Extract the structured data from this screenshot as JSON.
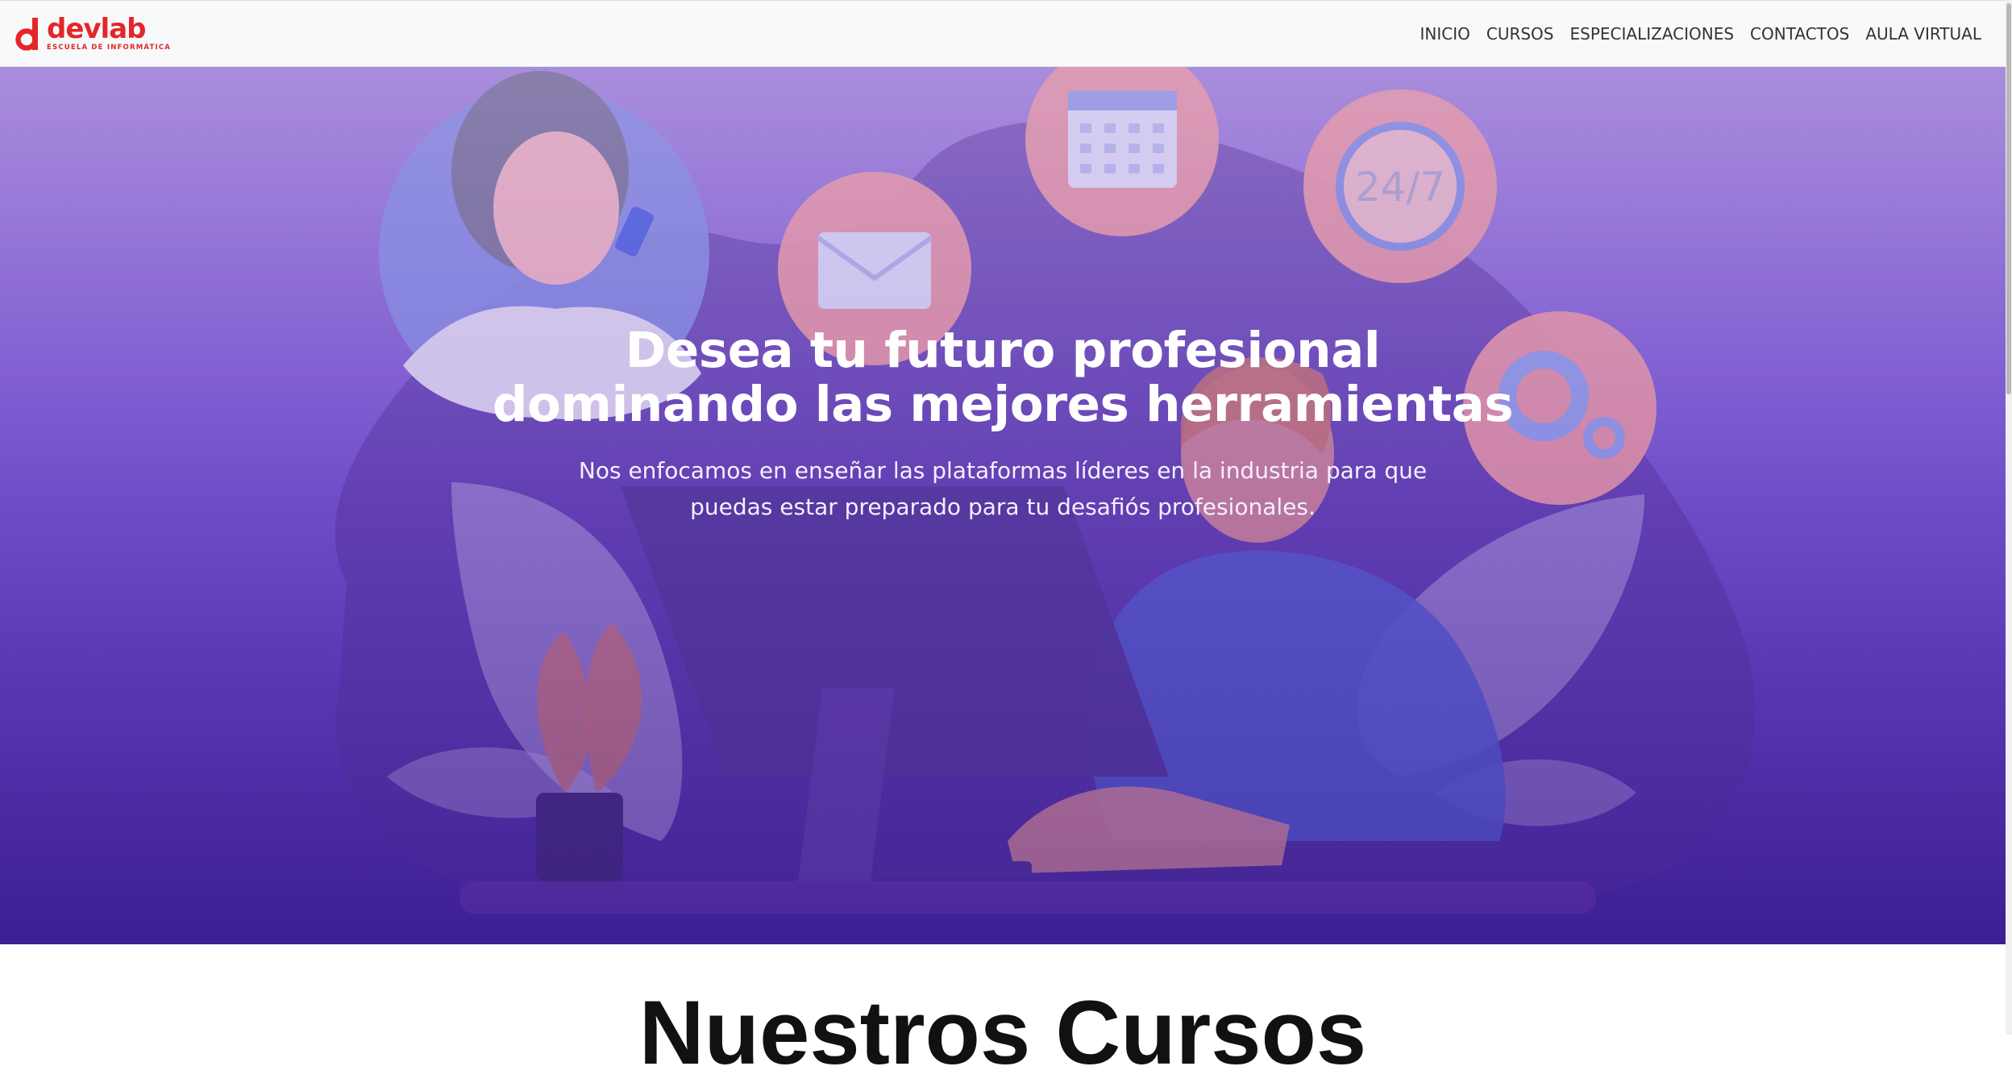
{
  "brand": {
    "name": "devlab",
    "tagline": "ESCUELA DE INFORMÁTICA",
    "logo_icon": "devlab-d-logo",
    "color": "#e3262b"
  },
  "nav": {
    "items": [
      {
        "label": "INICIO"
      },
      {
        "label": "CURSOS"
      },
      {
        "label": "ESPECIALIZACIONES"
      },
      {
        "label": "CONTACTOS"
      },
      {
        "label": "AULA VIRTUAL"
      }
    ]
  },
  "hero": {
    "title_line1": "Desea tu futuro profesional",
    "title_line2": "dominando las mejores herramientas",
    "subtitle": "Nos enfocamos en enseñar las plataformas líderes en la industria para que puedas estar preparado para tu desafiós profesionales.",
    "clock_text": "24/7",
    "gradient_top": "#9e83d6",
    "gradient_bottom": "#3c1f92",
    "icons": [
      "customer-support-woman",
      "envelope-icon",
      "calendar-icon",
      "clock-24-7-icon",
      "gears-icon",
      "plant-illustration",
      "computer-monitor-illustration",
      "man-with-headset-illustration"
    ]
  },
  "courses": {
    "heading": "Nuestros Cursos"
  }
}
